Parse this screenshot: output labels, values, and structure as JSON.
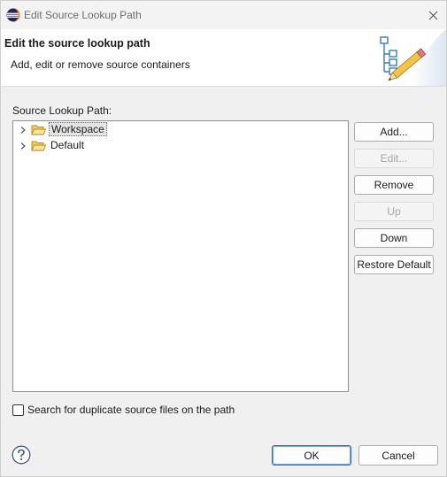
{
  "window": {
    "title": "Edit Source Lookup Path"
  },
  "header": {
    "title": "Edit the source lookup path",
    "subtitle": "Add, edit or remove source containers",
    "art_icon": "tree-pencil-icon"
  },
  "source_lookup": {
    "label": "Source Lookup Path:",
    "items": [
      {
        "label": "Workspace",
        "icon": "folder-open-icon",
        "selected": true
      },
      {
        "label": "Default",
        "icon": "folder-open-icon",
        "selected": false
      }
    ]
  },
  "buttons": {
    "add": "Add...",
    "edit": "Edit...",
    "remove": "Remove",
    "up": "Up",
    "down": "Down",
    "restore_default": "Restore Default"
  },
  "options": {
    "search_duplicates_label": "Search for duplicate source files on the path",
    "search_duplicates_checked": false
  },
  "footer": {
    "ok": "OK",
    "cancel": "Cancel",
    "help_icon": "question-mark-icon"
  },
  "colors": {
    "accent": "#2a6fc6",
    "folder": "#e8b84a",
    "selection": "#e4e4e4"
  }
}
